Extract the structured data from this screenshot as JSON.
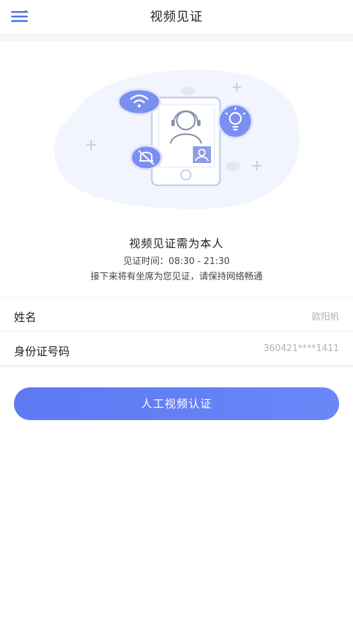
{
  "header": {
    "title": "视频见证",
    "menu_icon": "menu-icon"
  },
  "info": {
    "title": "视频见证需为本人",
    "time": "见证时间：08:30 - 21:30",
    "note": "接下来将有坐席为您见证，请保持网络畅通"
  },
  "form": {
    "name_label": "姓名",
    "name_value": "欧阳帆",
    "id_label": "身份证号码",
    "id_value": "360421****1411"
  },
  "actions": {
    "submit_label": "人工视频认证"
  },
  "colors": {
    "accent": "#6a84f5",
    "icon_fill": "#7b8ff0",
    "blob": "#f2f5fd"
  }
}
